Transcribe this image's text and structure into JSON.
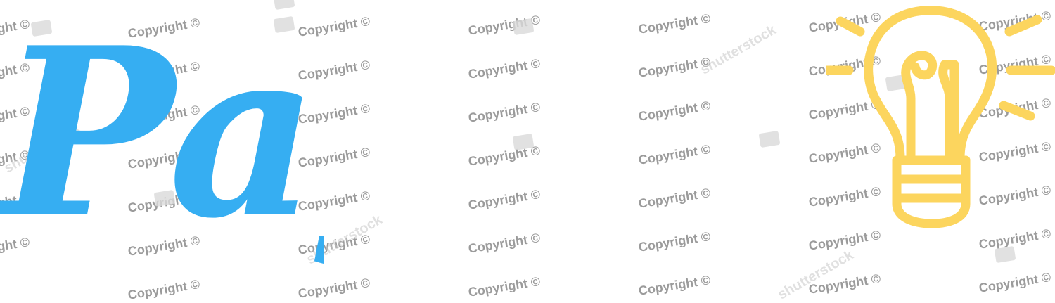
{
  "logo": {
    "text": "Pay",
    "color": "#36aef2"
  },
  "icon": {
    "name": "lightbulb-icon",
    "color": "#fcd55e"
  },
  "watermark": {
    "text": "Copyright ©",
    "brand_text": "shutterstock"
  }
}
